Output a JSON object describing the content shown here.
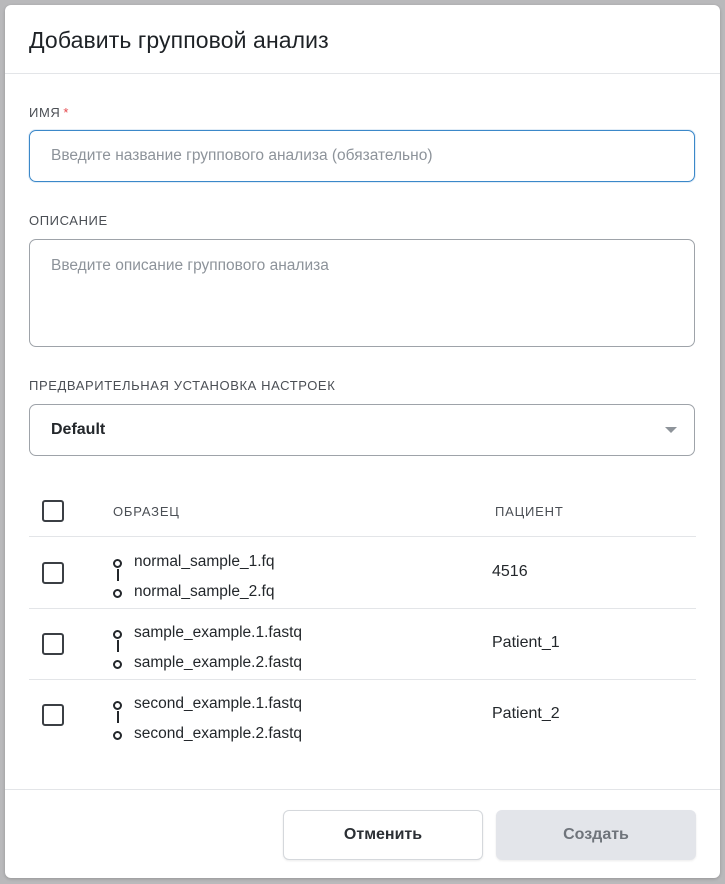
{
  "dialog": {
    "title": "Добавить групповой анализ",
    "name_field": {
      "label": "Имя",
      "required_mark": "*",
      "placeholder": "Введите название группового анализа (обязательно)",
      "value": ""
    },
    "description_field": {
      "label": "Описание",
      "placeholder": "Введите описание группового анализа",
      "value": ""
    },
    "preset_field": {
      "label": "Предварительная установка настроек",
      "selected": "Default"
    },
    "table": {
      "columns": [
        "Образец",
        "Пациент"
      ],
      "rows": [
        {
          "sample_1": "normal_sample_1.fq",
          "sample_2": "normal_sample_2.fq",
          "patient": "4516",
          "checked": false
        },
        {
          "sample_1": "sample_example.1.fastq",
          "sample_2": "sample_example.2.fastq",
          "patient": "Patient_1",
          "checked": false
        },
        {
          "sample_1": "second_example.1.fastq",
          "sample_2": "second_example.2.fastq",
          "patient": "Patient_2",
          "checked": false
        }
      ]
    },
    "buttons": {
      "cancel": "Отменить",
      "create": "Создать"
    },
    "colors": {
      "focus_border": "#3b88c9",
      "required": "#e5484d",
      "disabled_button_bg": "#e3e5ea"
    }
  }
}
